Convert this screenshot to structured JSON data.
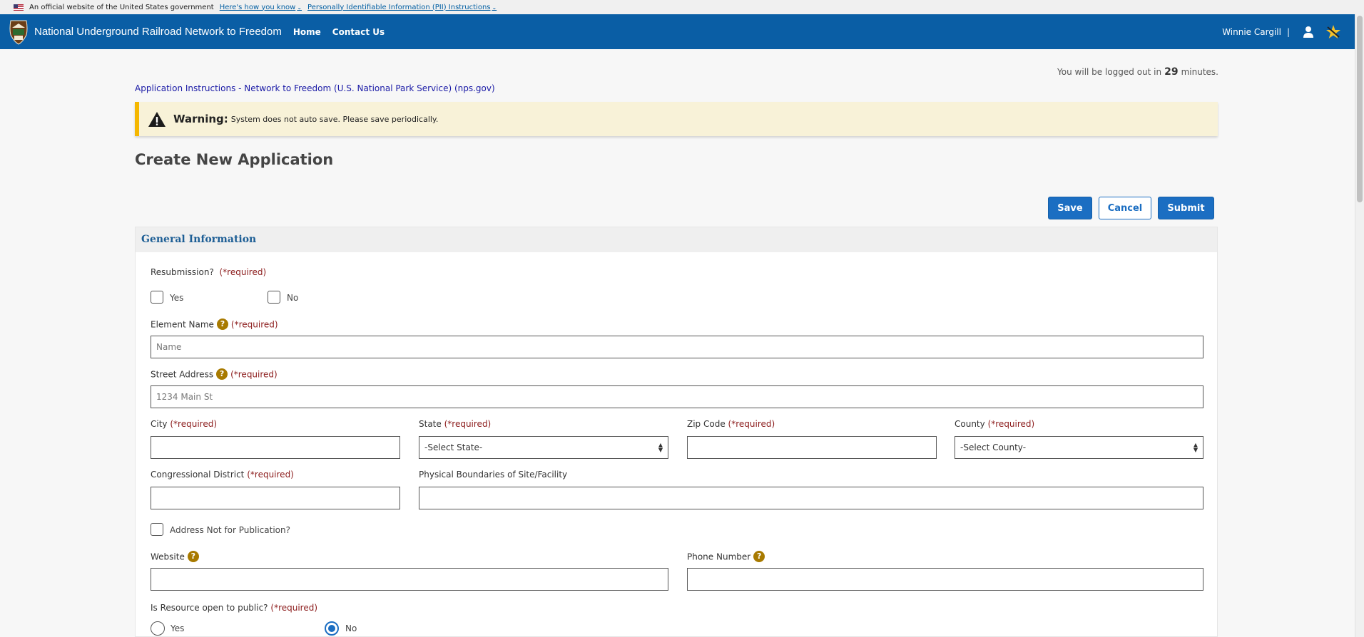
{
  "gov_banner": {
    "text": "An official website of the United States government",
    "link1": "Here's how you know",
    "link2": "Personally Identifiable Information (PII) Instructions"
  },
  "header": {
    "title": "National Underground Railroad Network to Freedom",
    "nav": [
      "Home",
      "Contact Us"
    ],
    "user_name": "Winnie Cargill",
    "separator": "|"
  },
  "logout": {
    "prefix": "You will be logged out in",
    "minutes": "29",
    "suffix": "minutes."
  },
  "instructions_link": "Application Instructions - Network to Freedom (U.S. National Park Service) (nps.gov)",
  "warning": {
    "title": "Warning:",
    "text": "System does not auto save. Please save periodically."
  },
  "page_title": "Create New Application",
  "buttons": {
    "save": "Save",
    "cancel": "Cancel",
    "submit": "Submit"
  },
  "section_title": "General Information",
  "form": {
    "required": "(*required)",
    "help": "?",
    "resubmission": {
      "label": "Resubmission?",
      "yes": "Yes",
      "no": "No"
    },
    "element_name": {
      "label": "Element Name",
      "placeholder": "Name"
    },
    "street_address": {
      "label": "Street Address",
      "placeholder": "1234 Main St"
    },
    "city": {
      "label": "City"
    },
    "state": {
      "label": "State",
      "selected": "-Select State-"
    },
    "zip": {
      "label": "Zip Code"
    },
    "county": {
      "label": "County",
      "selected": "-Select County-"
    },
    "congressional_district": {
      "label": "Congressional District"
    },
    "physical_boundaries": {
      "label": "Physical Boundaries of Site/Facility"
    },
    "address_not_pub": {
      "label": "Address Not for Publication?"
    },
    "website": {
      "label": "Website"
    },
    "phone": {
      "label": "Phone Number"
    },
    "open_public": {
      "label": "Is Resource open to public?",
      "required": "(*required)",
      "yes": "Yes",
      "no": "No",
      "selected": "No"
    }
  },
  "colors": {
    "header_blue": "#0a5ea5",
    "button_blue": "#1b6ec2",
    "warning_bg": "#f8f2d8",
    "warning_border": "#f5b700",
    "required_red": "#8b1a1a"
  }
}
